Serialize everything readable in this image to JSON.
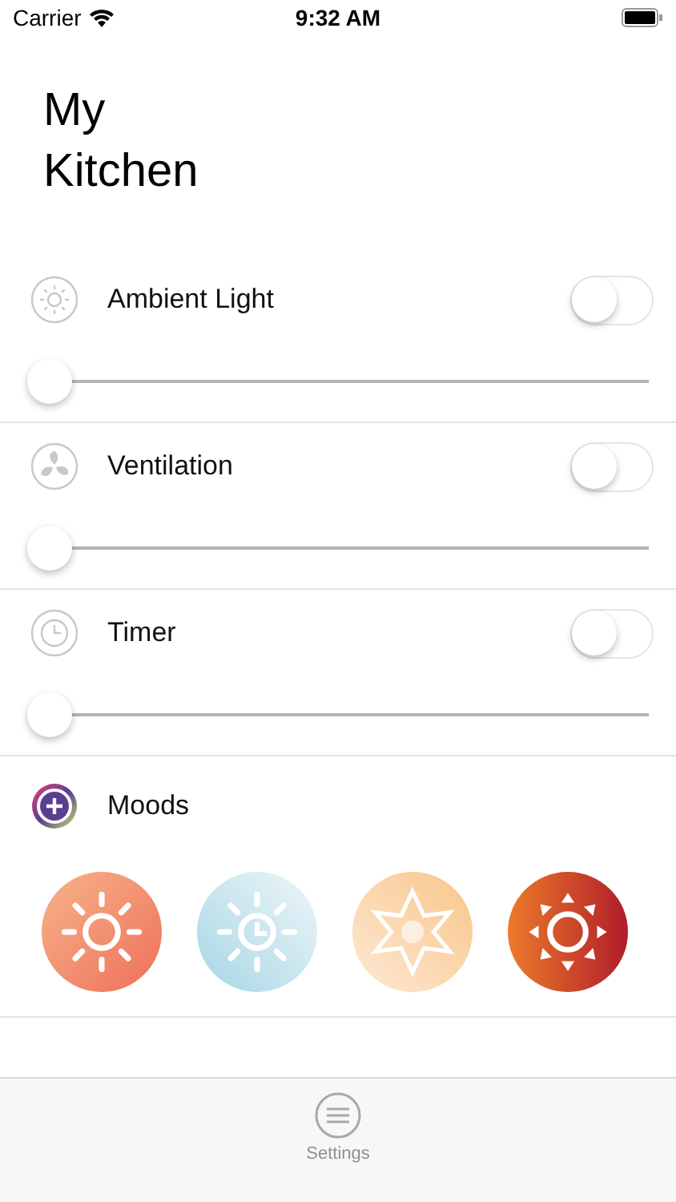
{
  "status_bar": {
    "carrier": "Carrier",
    "time": "9:32 AM"
  },
  "title": "My Kitchen",
  "controls": [
    {
      "kind": "light",
      "label": "Ambient Light",
      "on": false,
      "level": 0
    },
    {
      "kind": "fan",
      "label": "Ventilation",
      "on": false,
      "level": 0
    },
    {
      "kind": "timer",
      "label": "Timer",
      "on": false,
      "level": 0
    }
  ],
  "moods": {
    "label": "Moods",
    "items": [
      {
        "kind": "sun"
      },
      {
        "kind": "sun-clock"
      },
      {
        "kind": "star"
      },
      {
        "kind": "sun-arrows"
      }
    ]
  },
  "tab_bar": {
    "items": [
      {
        "label": "Settings",
        "selected": false
      }
    ]
  }
}
